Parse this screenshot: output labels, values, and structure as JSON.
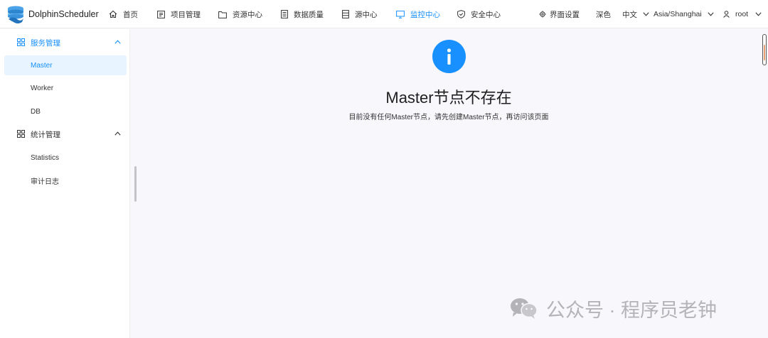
{
  "app": {
    "title": "DolphinScheduler",
    "accent_color": "#1890ff"
  },
  "nav": [
    {
      "label": "首页",
      "icon": "home-icon"
    },
    {
      "label": "项目管理",
      "icon": "project-icon"
    },
    {
      "label": "资源中心",
      "icon": "folder-icon"
    },
    {
      "label": "数据质量",
      "icon": "document-icon"
    },
    {
      "label": "源中心",
      "icon": "database-icon"
    },
    {
      "label": "监控中心",
      "icon": "monitor-icon",
      "active": true
    },
    {
      "label": "安全中心",
      "icon": "shield-icon"
    }
  ],
  "header_right": {
    "ui_settings": "界面设置",
    "theme": "深色",
    "language": "中文",
    "timezone": "Asia/Shanghai",
    "user": "root"
  },
  "sidebar": {
    "groups": [
      {
        "label": "服务管理",
        "items": [
          "Master",
          "Worker",
          "DB"
        ]
      },
      {
        "label": "统计管理",
        "items": [
          "Statistics",
          "审计日志"
        ]
      }
    ],
    "selected": "Master"
  },
  "result": {
    "icon": "info-icon",
    "title": "Master节点不存在",
    "description": "目前没有任何Master节点，请先创建Master节点，再访问该页面"
  },
  "watermark": {
    "text": "公众号 · 程序员老钟",
    "icon": "wechat-icon"
  }
}
